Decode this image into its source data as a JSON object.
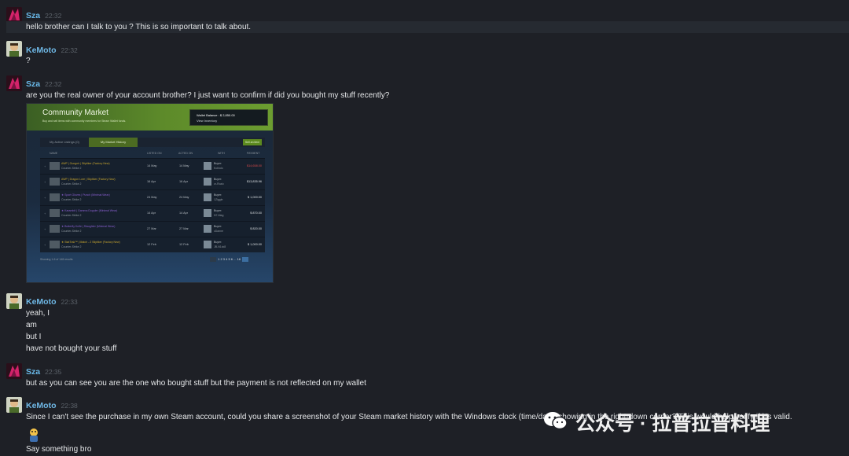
{
  "messages": [
    {
      "author": "Sza",
      "time": "22:32",
      "lines": [
        "hello brother can I talk to you ? This is so important to talk about."
      ]
    },
    {
      "author": "KeMoto",
      "time": "22:32",
      "lines": [
        "?"
      ]
    },
    {
      "author": "Sza",
      "time": "22:32",
      "lines": [
        "are you the real owner of your account brother? I just want to confirm if did you bought my stuff recently?"
      ]
    },
    {
      "author": "KeMoto",
      "time": "22:33",
      "lines": [
        "yeah, I",
        "am",
        "but I",
        "have not bought your stuff"
      ]
    },
    {
      "author": "Sza",
      "time": "22:35",
      "lines": [
        "but as you can see you are the one who bought stuff but the payment is not reflected on my wallet"
      ]
    },
    {
      "author": "KeMoto",
      "time": "22:38",
      "lines": [
        "Since I can't see the purchase in my own Steam account, could you share a screenshot of your Steam market history with the Windows clock (time/date) showing in the right-down corner? This would help verify if it's valid.",
        "Say something bro"
      ]
    }
  ],
  "market": {
    "title": "Community Market",
    "subtitle": "Buy and sell items with community members for Steam Wallet funds.",
    "wallet_balance": "Wallet Balance : $ 2,850.00",
    "view_inventory": "View Inventory",
    "tabs": [
      "My Active Listings (0)",
      "My Market History"
    ],
    "sell_button": "Sell an item",
    "columns": [
      "NAME",
      "LISTED ON",
      "ACTED ON",
      "WITH",
      "PAYMENT"
    ],
    "rows": [
      {
        "name": "AWP | Gungnir | Stiptiker (Factory New)",
        "game": "Counter-Strike 2",
        "listed": "14 May",
        "acted": "14 May",
        "buyer": "Buyer:",
        "buyer_name": "Kolindo",
        "price": "$14,658.00",
        "color": "#c9a62f",
        "price_color": "#d94a4a"
      },
      {
        "name": "AWP | Dragon Lore | Stiptiker (Factory New)",
        "game": "Counter-Strike 2",
        "listed": "16 Apr",
        "acted": "16 Apr",
        "buyer": "Buyer:",
        "buyer_name": "cr-Rozic",
        "price": "$13,835.96",
        "color": "#c9a62f",
        "price_color": "#dfe3e6"
      },
      {
        "name": "★ Sport Gloves | Punch (Minimal Wear)",
        "game": "Counter-Strike 2",
        "listed": "24 May",
        "acted": "24 May",
        "buyer": "Buyer:",
        "buyer_name": "1Ziggle",
        "price": "$ 1,000.00",
        "color": "#8a5fd0",
        "price_color": "#dfe3e6"
      },
      {
        "name": "★ Karambit | Gamma Doppler (Minimal Wear)",
        "game": "Counter-Strike 2",
        "listed": "14 Apr",
        "acted": "14 Apr",
        "buyer": "Buyer:",
        "buyer_name": "N7-Mag",
        "price": "$ 870.00",
        "color": "#8a5fd0",
        "price_color": "#dfe3e6"
      },
      {
        "name": "★ Butterfly Knife | Slaughter (Minimal Wear)",
        "game": "Counter-Strike 2",
        "listed": "27 Mar",
        "acted": "27 Mar",
        "buyer": "Buyer:",
        "buyer_name": "cDanne",
        "price": "$ 820.00",
        "color": "#8a5fd0",
        "price_color": "#dfe3e6"
      },
      {
        "name": "★ StatTrak™ | Match - 2 Stiptiker (Factory New)",
        "game": "Counter-Strike 2",
        "listed": "12 Feb",
        "acted": "12 Feb",
        "buyer": "Buyer:",
        "buyer_name": "JB-N1ck8",
        "price": "$ 1,000.00",
        "color": "#c9a62f",
        "price_color": "#dfe3e6"
      }
    ],
    "showing": "Showing 1-6 of 148 results",
    "pages": "1 2 3 4 5 6 ... 18"
  },
  "watermark": "公众号 · 拉普拉普料理",
  "colors": {
    "background": "#1e2026",
    "author": "#69b8e8",
    "steam_green": "#5c8a1f"
  }
}
